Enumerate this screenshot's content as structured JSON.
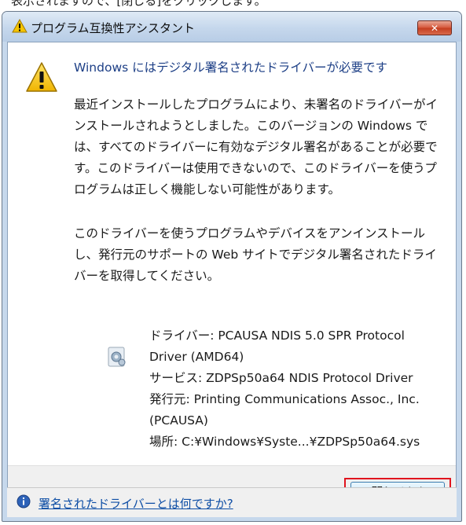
{
  "caption_strip": "表示されますので、[閉じる]をクリックします。",
  "window": {
    "title": "プログラム互換性アシスタント",
    "close_symbol": "✕"
  },
  "content": {
    "heading": "Windows にはデジタル署名されたドライバーが必要です",
    "paragraph1": "最近インストールしたプログラムにより、未署名のドライバーがインストールされようとしました。このバージョンの Windows では、すべてのドライバーに有効なデジタル署名があることが必要です。このドライバーは使用できないので、このドライバーを使うプログラムは正しく機能しない可能性があります。",
    "paragraph2": "このドライバーを使うプログラムやデバイスをアンインストールし、発行元のサポートの Web サイトでデジタル署名されたドライバーを取得してください。"
  },
  "driver": {
    "line1": "ドライバー: PCAUSA NDIS 5.0 SPR Protocol",
    "line2": "Driver (AMD64)",
    "service": "サービス: ZDPSp50a64 NDIS Protocol Driver",
    "publisher1": "発行元: Printing Communications Assoc., Inc.",
    "publisher2": "(PCAUSA)",
    "location": "場所: C:¥Windows¥Syste...¥ZDPSp50a64.sys"
  },
  "buttons": {
    "close_label": "閉じる(C)"
  },
  "footer": {
    "link": "署名されたドライバーとは何ですか?"
  },
  "icons": {
    "title": "warning-icon",
    "main": "warning-icon",
    "driver": "driver-gear-icon",
    "footer": "info-icon"
  },
  "colors": {
    "heading": "#1d3f86",
    "link": "#0e4ea5",
    "highlight": "#e0141e",
    "close": "#c43d1f"
  }
}
